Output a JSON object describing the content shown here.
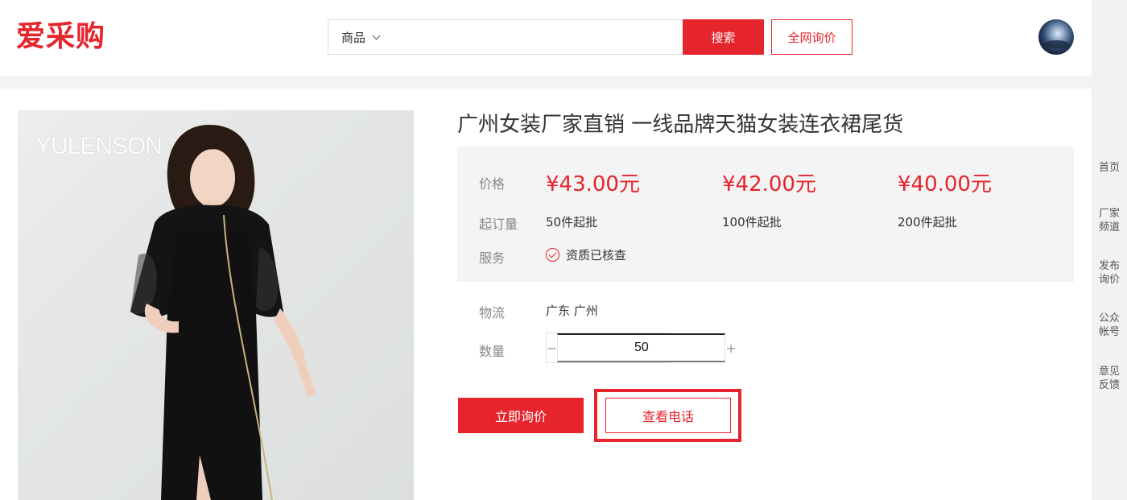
{
  "header": {
    "logo": "爱采购",
    "search_category": "商品",
    "search_placeholder": "",
    "search_button": "搜索",
    "quote_all_button": "全网询价"
  },
  "sidebar": {
    "items": [
      {
        "line1": "首页",
        "line2": ""
      },
      {
        "line1": "厂家",
        "line2": "频道"
      },
      {
        "line1": "发布",
        "line2": "询价"
      },
      {
        "line1": "公众",
        "line2": "帐号"
      },
      {
        "line1": "意见",
        "line2": "反馈"
      }
    ]
  },
  "product": {
    "image_brand": "YULENSON",
    "title": "广州女装厂家直销 一线品牌天猫女装连衣裙尾货",
    "price_label": "价格",
    "tiers": [
      {
        "price": "¥43.00元",
        "moq": "50件起批"
      },
      {
        "price": "¥42.00元",
        "moq": "100件起批"
      },
      {
        "price": "¥40.00元",
        "moq": "200件起批"
      }
    ],
    "moq_label": "起订量",
    "service_label": "服务",
    "service_value": "资质已核查",
    "logistics_label": "物流",
    "logistics_value": "广东 广州",
    "quantity_label": "数量",
    "quantity_value": "50",
    "minus": "−",
    "plus": "+"
  },
  "actions": {
    "inquire_button": "立即询价",
    "phone_button": "查看电话"
  },
  "colors": {
    "accent": "#e5242b",
    "panel_bg": "#f4f4f4"
  }
}
